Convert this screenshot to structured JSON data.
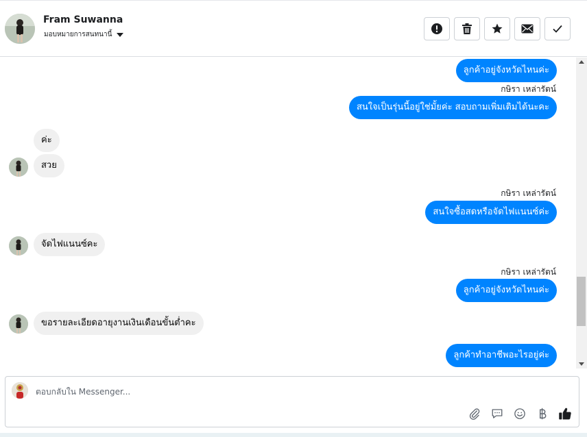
{
  "header": {
    "contact_name": "Fram Suwanna",
    "assign_label": "มอบหมายการสนทนานี้",
    "actions": [
      {
        "name": "mark-spam-button",
        "icon": "exclamation-icon"
      },
      {
        "name": "delete-button",
        "icon": "trash-icon"
      },
      {
        "name": "star-button",
        "icon": "star-icon"
      },
      {
        "name": "mark-unread-button",
        "icon": "envelope-icon"
      },
      {
        "name": "mark-done-button",
        "icon": "check-icon"
      }
    ]
  },
  "messages": [
    {
      "direction": "out",
      "text": "ลูกค้าอยู่จังหวัดไหนค่ะ"
    },
    {
      "direction": "out",
      "sender": "กษิรา เหล่ารัตน์",
      "text": "สนใจเป็นรุ่นนี้อยู่ใช่มั้ยค่ะ สอบถามเพิ่มเติมได้นะคะ"
    },
    {
      "direction": "in",
      "text": "ค่ะ"
    },
    {
      "direction": "in",
      "text": "สวย"
    },
    {
      "direction": "out",
      "sender": "กษิรา เหล่ารัตน์",
      "text": "สนใจซื้อสดหรือจัดไฟแนนซ์ค่ะ"
    },
    {
      "direction": "in",
      "text": "จัดไฟแนนซ์คะ"
    },
    {
      "direction": "out",
      "sender": "กษิรา เหล่ารัตน์",
      "text": "ลูกค้าอยู่จังหวัดไหนค่ะ"
    },
    {
      "direction": "in",
      "text": "ขอรายละเอียดอายุงานเงินเดือนขั้นต่ำคะ"
    },
    {
      "direction": "out",
      "text": "ลูกค้าทำอาชีพอะไรอยู่ค่ะ"
    }
  ],
  "composer": {
    "placeholder": "ตอบกลับใน Messenger...",
    "tools": [
      "paperclip-icon",
      "saved-reply-icon",
      "emoji-icon",
      "baht-icon",
      "thumbs-up-icon"
    ]
  },
  "colors": {
    "outgoing_bubble": "#0084ff",
    "incoming_bubble": "#f0f0f0",
    "divider": "#dadde1"
  }
}
